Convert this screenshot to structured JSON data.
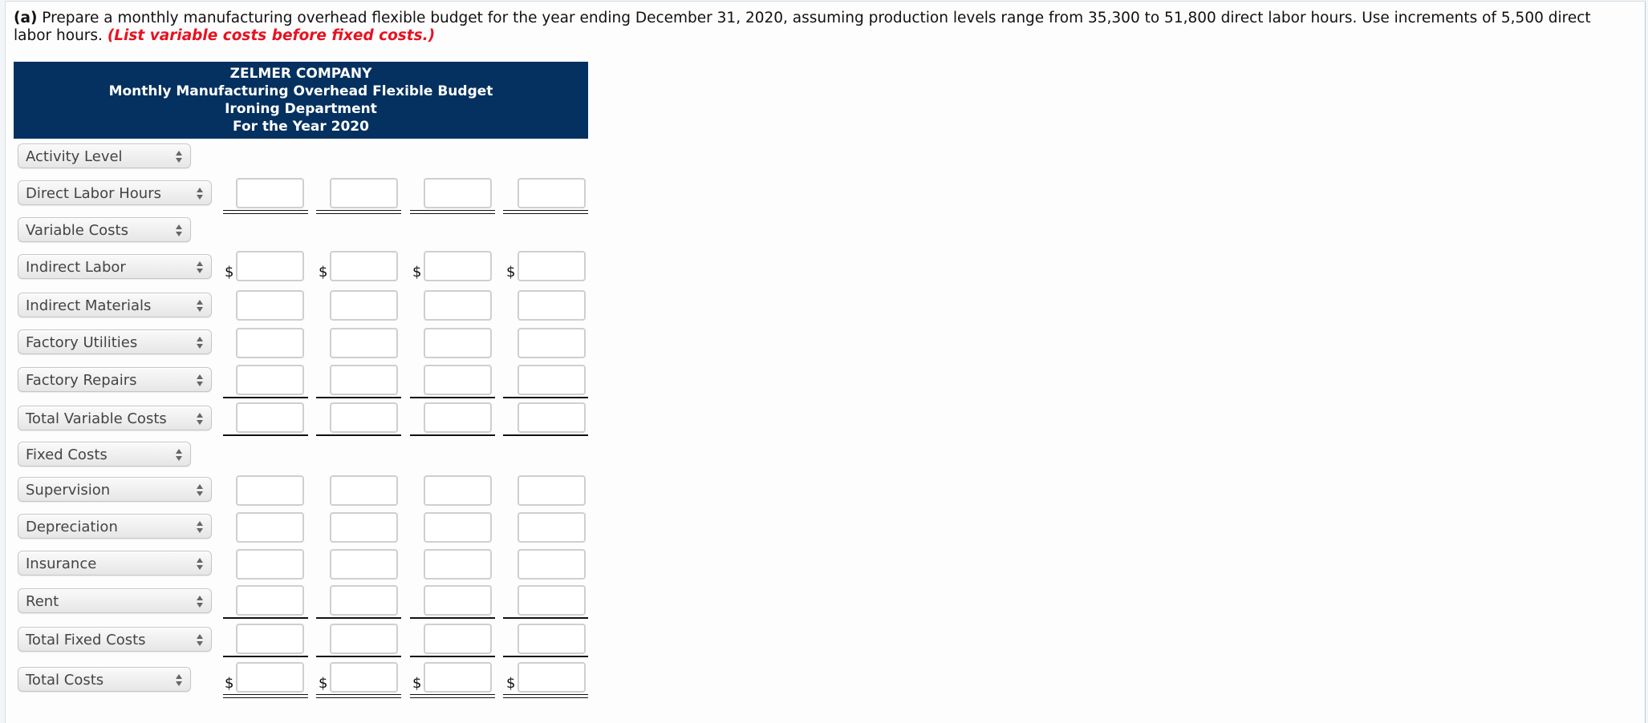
{
  "instructions": {
    "lead": "(a)",
    "text": " Prepare a monthly manufacturing overhead flexible budget for the year ending December 31, 2020, assuming production levels range from 35,300 to 51,800 direct labor hours. Use increments of 5,500 direct labor hours. ",
    "note": "(List variable costs before fixed costs.)"
  },
  "header": {
    "company": "ZELMER COMPANY",
    "title": "Monthly Manufacturing Overhead Flexible Budget",
    "department": "Ironing Department",
    "period": "For the Year 2020"
  },
  "colors": {
    "header_bg": "#04315f",
    "note_red": "#e8111f"
  },
  "currency_symbol": "$",
  "rows": [
    {
      "label": "Activity Level",
      "inputs": false
    },
    {
      "label": "Direct Labor Hours",
      "inputs": true,
      "values": [
        "",
        "",
        "",
        ""
      ]
    },
    {
      "label": "Variable Costs",
      "inputs": false
    },
    {
      "label": "Indirect Labor",
      "inputs": true,
      "dollar": true,
      "values": [
        "",
        "",
        "",
        ""
      ]
    },
    {
      "label": "Indirect Materials",
      "inputs": true,
      "values": [
        "",
        "",
        "",
        ""
      ]
    },
    {
      "label": "Factory Utilities",
      "inputs": true,
      "values": [
        "",
        "",
        "",
        ""
      ]
    },
    {
      "label": "Factory Repairs",
      "inputs": true,
      "values": [
        "",
        "",
        "",
        ""
      ]
    },
    {
      "label": "Total Variable Costs",
      "inputs": true,
      "values": [
        "",
        "",
        "",
        ""
      ]
    },
    {
      "label": "Fixed Costs",
      "inputs": false
    },
    {
      "label": "Supervision",
      "inputs": true,
      "values": [
        "",
        "",
        "",
        ""
      ]
    },
    {
      "label": "Depreciation",
      "inputs": true,
      "values": [
        "",
        "",
        "",
        ""
      ]
    },
    {
      "label": "Insurance",
      "inputs": true,
      "values": [
        "",
        "",
        "",
        ""
      ]
    },
    {
      "label": "Rent",
      "inputs": true,
      "values": [
        "",
        "",
        "",
        ""
      ]
    },
    {
      "label": "Total Fixed Costs",
      "inputs": true,
      "values": [
        "",
        "",
        "",
        ""
      ]
    },
    {
      "label": "Total Costs",
      "inputs": true,
      "dollar": true,
      "values": [
        "",
        "",
        "",
        ""
      ]
    }
  ]
}
